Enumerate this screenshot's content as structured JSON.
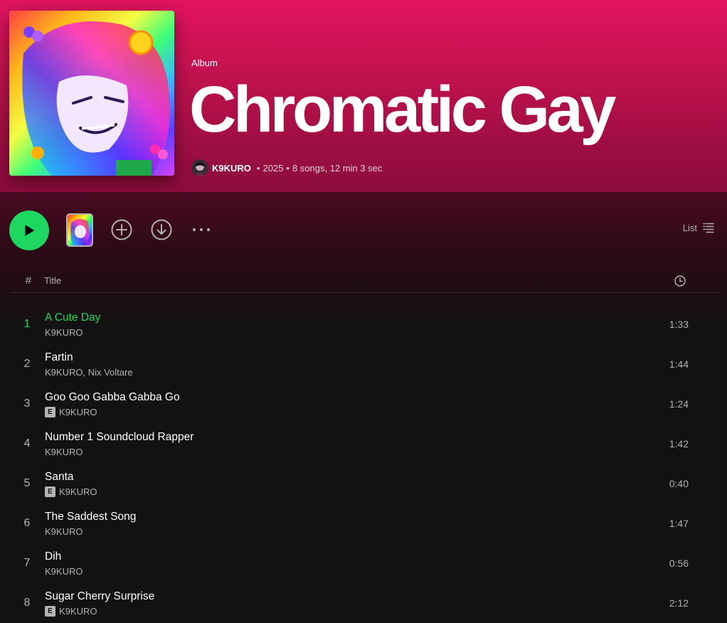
{
  "header": {
    "album_type": "Album",
    "title": "Chromatic Gay",
    "artist": "K9KURO",
    "year": "2025",
    "summary": "8 songs, 12 min 3 sec"
  },
  "actions": {
    "play_icon": "play-icon",
    "add_icon": "add-circle-icon",
    "download_icon": "download-icon",
    "more_icon": "more-icon",
    "view_label": "List",
    "view_icon": "list-icon"
  },
  "tracklist_header": {
    "num": "#",
    "title": "Title",
    "duration_icon": "clock-icon"
  },
  "tracks": [
    {
      "num": "1",
      "title": "A Cute Day",
      "artists": "K9KURO",
      "explicit": false,
      "duration": "1:33",
      "playing": true
    },
    {
      "num": "2",
      "title": "Fartin",
      "artists": "K9KURO, Nix Voltare",
      "explicit": false,
      "duration": "1:44",
      "playing": false
    },
    {
      "num": "3",
      "title": "Goo Goo Gabba Gabba Go",
      "artists": "K9KURO",
      "explicit": true,
      "duration": "1:24",
      "playing": false
    },
    {
      "num": "4",
      "title": "Number 1 Soundcloud Rapper",
      "artists": "K9KURO",
      "explicit": false,
      "duration": "1:42",
      "playing": false
    },
    {
      "num": "5",
      "title": "Santa",
      "artists": "K9KURO",
      "explicit": true,
      "duration": "0:40",
      "playing": false
    },
    {
      "num": "6",
      "title": "The Saddest Song",
      "artists": "K9KURO",
      "explicit": false,
      "duration": "1:47",
      "playing": false
    },
    {
      "num": "7",
      "title": "Dih",
      "artists": "K9KURO",
      "explicit": false,
      "duration": "0:56",
      "playing": false
    },
    {
      "num": "8",
      "title": "Sugar Cherry Surprise",
      "artists": "K9KURO",
      "explicit": true,
      "duration": "2:12",
      "playing": false
    }
  ],
  "explicit_label": "E",
  "colors": {
    "accent": "#1ed760",
    "header_top": "#e2145f",
    "header_bottom": "#8c0d3b",
    "background": "#121212",
    "muted_text": "#b3b3b3"
  }
}
